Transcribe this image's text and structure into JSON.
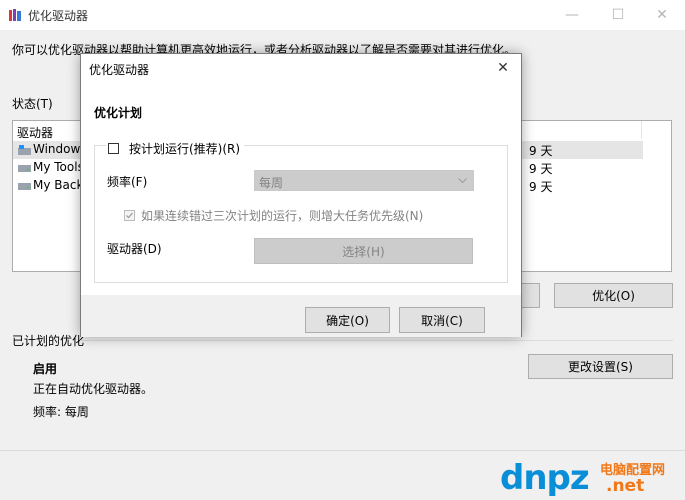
{
  "window": {
    "title": "优化驱动器",
    "description": "你可以优化驱动器以帮助计算机更高效地运行，或者分析驱动器以了解是否需要对其进行优化。",
    "status_label": "状态(T)",
    "list_header": "驱动器",
    "drives": [
      {
        "name": "Windows",
        "days": "9 天"
      },
      {
        "name": "My Tools",
        "days": "9 天"
      },
      {
        "name": "My Backu",
        "days": "9 天"
      }
    ],
    "analyze_button": "",
    "optimize_button": "优化(O)",
    "scheduled_label": "已计划的优化",
    "enabled_label": "启用",
    "auto_optimizing": "正在自动优化驱动器。",
    "frequency_text": "频率: 每周",
    "change_settings_button": "更改设置(S)",
    "controls": {
      "minimize": "—",
      "maximize": "☐",
      "close": "✕"
    }
  },
  "dialog": {
    "title": "优化驱动器",
    "section_title": "优化计划",
    "run_on_schedule": "按计划运行(推荐)(R)",
    "frequency_label": "频率(F)",
    "frequency_value": "每周",
    "increase_priority": "如果连续错过三次计划的运行，则增大任务优先级(N)",
    "drives_label": "驱动器(D)",
    "choose_button": "选择(H)",
    "ok_button": "确定(O)",
    "cancel_button": "取消(C)",
    "close_glyph": "✕"
  },
  "watermark": {
    "dn": "dnpz",
    "cn": "电脑配置网",
    "net": ".net"
  }
}
